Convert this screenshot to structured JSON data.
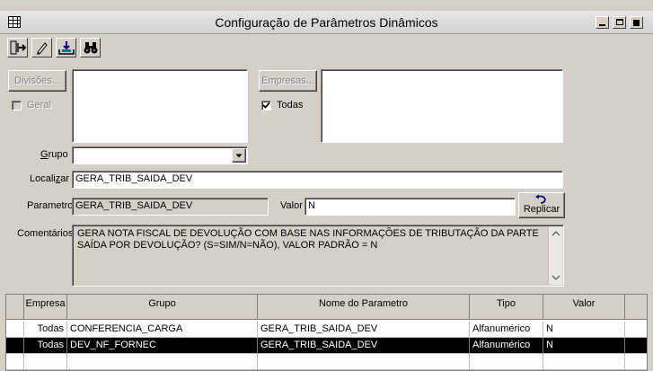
{
  "window": {
    "title": "Configuração de Parâmetros Dinâmicos"
  },
  "toolbar": {
    "icons": [
      "exit-door-icon",
      "pencil-icon",
      "save-tray-icon",
      "binoculars-icon"
    ]
  },
  "filters": {
    "divisoes_label": "Divisões...",
    "geral_label": "Geral",
    "empresas_label": "Empresas...",
    "todas_label": "Todas",
    "grupo_label": "Grupo",
    "grupo_value": ""
  },
  "form": {
    "localizar_label": "Localizar",
    "localizar_value": "GERA_TRIB_SAIDA_DEV",
    "parametro_label": "Parametro",
    "parametro_value": "GERA_TRIB_SAIDA_DEV",
    "valor_label": "Valor",
    "valor_value": "N",
    "replicar_label": "Replicar",
    "comentarios_label": "Comentários",
    "comentarios_line1": "GERA NOTA FISCAL DE DEVOLUÇÃO COM BASE NAS INFORMAÇÕES DE TRIBUTAÇÃO DA PARTE",
    "comentarios_line2": "SAÍDA POR DEVOLUÇÃO? (S=SIM/N=NÃO), VALOR PADRÃO = N"
  },
  "grid": {
    "columns": [
      "Empresa",
      "Grupo",
      "Nome do Parametro",
      "Tipo",
      "Valor"
    ],
    "rows": [
      {
        "empresa": "Todas",
        "grupo": "CONFERENCIA_CARGA",
        "nome": "GERA_TRIB_SAIDA_DEV",
        "tipo": "Alfanumérico",
        "valor": "N"
      },
      {
        "empresa": "Todas",
        "grupo": "DEV_NF_FORNEC",
        "nome": "GERA_TRIB_SAIDA_DEV",
        "tipo": "Alfanumérico",
        "valor": "N"
      }
    ],
    "selected_row": 1
  }
}
